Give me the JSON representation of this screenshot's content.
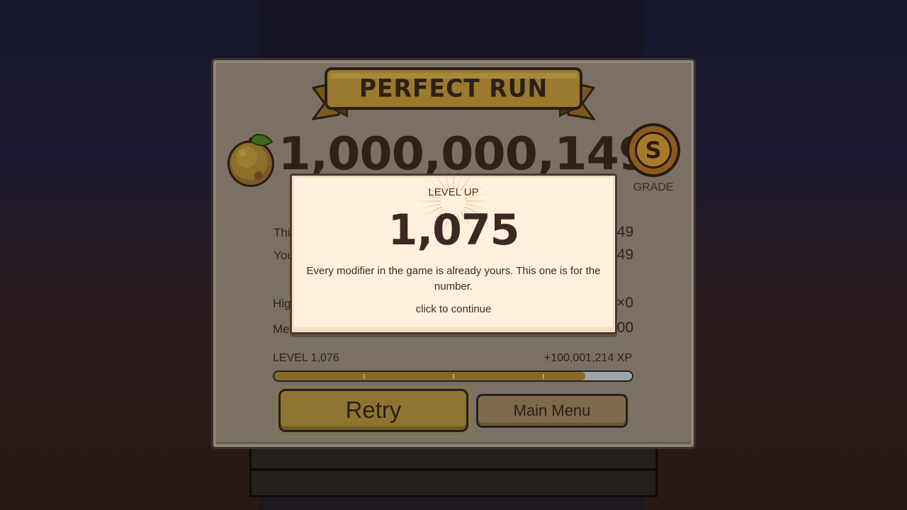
{
  "results": {
    "banner_title": "PERFECT RUN",
    "score": "1,000,000,149",
    "grade": "S",
    "grade_label": "GRADE",
    "stats": [
      {
        "label": "Thi",
        "value": "49"
      },
      {
        "label": "You",
        "value": "49"
      },
      {
        "label": "Hig",
        "value": "×0"
      },
      {
        "label": "Mer",
        "value": "00"
      }
    ],
    "level_label": "LEVEL 1,076",
    "xp_gain": "+100,001,214 XP",
    "xp_progress": 0.87,
    "retry_label": "Retry",
    "main_menu_label": "Main Menu"
  },
  "level_up": {
    "title": "LEVEL UP",
    "level": "1,075",
    "message": "Every modifier in the game is already yours. This one is for the number.",
    "hint": "click to continue"
  },
  "colors": {
    "panel": "#7a7064",
    "ribbon": "#9a7a2e",
    "modal": "#fff1dd",
    "retry": "#8e7430",
    "main_menu": "#7e6a4a",
    "xp_fill": "#8a6a26",
    "xp_track": "#9fa3ab"
  },
  "icons": {
    "fruit": "orange-fruit-icon",
    "grade": "grade-medal-icon",
    "burst": "sunburst-icon"
  }
}
